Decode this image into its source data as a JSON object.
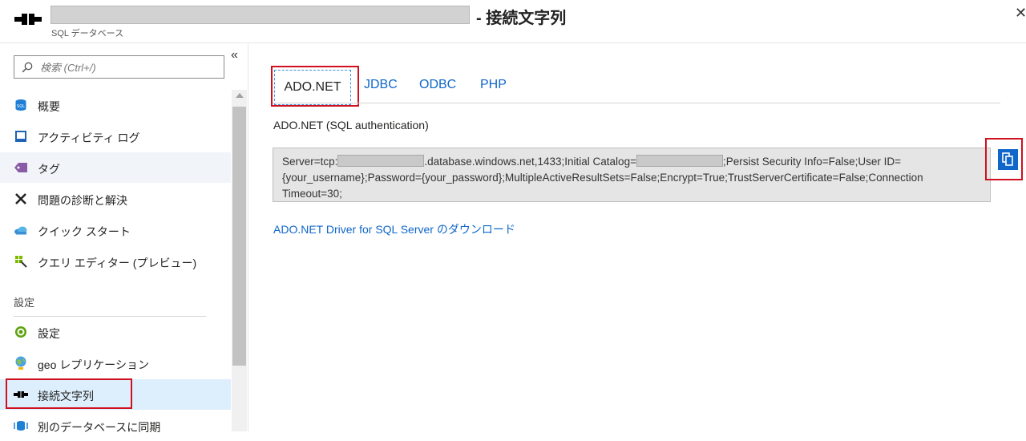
{
  "header": {
    "title_suffix": "- 接続文字列",
    "subtitle": "SQL データベース",
    "close_glyph": "✕"
  },
  "sidebar": {
    "search_placeholder": "検索 (Ctrl+/)",
    "collapse_glyph": "«",
    "items": [
      {
        "label": "概要",
        "icon": "sql-database-icon"
      },
      {
        "label": "アクティビティ ログ",
        "icon": "activity-log-icon"
      },
      {
        "label": "タグ",
        "icon": "tag-icon"
      },
      {
        "label": "問題の診断と解決",
        "icon": "tools-icon"
      },
      {
        "label": "クイック スタート",
        "icon": "cloud-icon"
      },
      {
        "label": "クエリ エディター (プレビュー)",
        "icon": "query-editor-icon"
      },
      {
        "label": "設定",
        "icon": "settings-icon"
      },
      {
        "label": "geo レプリケーション",
        "icon": "globe-icon"
      },
      {
        "label": "接続文字列",
        "icon": "connection-icon"
      },
      {
        "label": "別のデータベースに同期",
        "icon": "sync-icon"
      }
    ],
    "section_settings": "設定"
  },
  "main": {
    "tabs": [
      {
        "label": "ADO.NET",
        "active": true
      },
      {
        "label": "JDBC"
      },
      {
        "label": "ODBC"
      },
      {
        "label": "PHP"
      }
    ],
    "connection_label": "ADO.NET (SQL authentication)",
    "conn_part1": "Server=tcp:",
    "conn_part2": ".database.windows.net,1433;Initial Catalog=",
    "conn_part3": ";Persist Security Info=False;User ID={your_username};Password={your_password};MultipleActiveResultSets=False;Encrypt=True;TrustServerCertificate=False;Connection Timeout=30;",
    "download_link": "ADO.NET Driver for SQL Server のダウンロード"
  },
  "colors": {
    "accent": "#1067c9",
    "highlight_red": "#d0101f",
    "selected_bg": "#ddeefc"
  }
}
